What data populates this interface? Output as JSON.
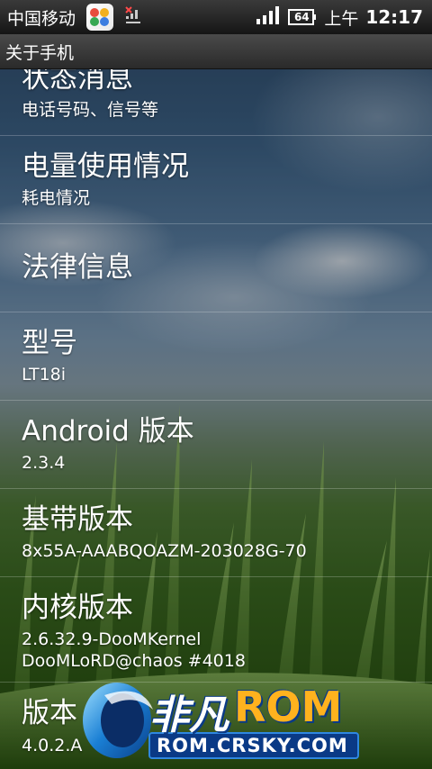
{
  "statusbar": {
    "carrier": "中国移动",
    "battery": "64",
    "ampm": "上午",
    "time": "12:17"
  },
  "titlebar": {
    "title": "关于手机"
  },
  "items": [
    {
      "title": "状态消息",
      "subtitle": "电话号码、信号等"
    },
    {
      "title": "电量使用情况",
      "subtitle": "耗电情况"
    },
    {
      "title": "法律信息",
      "subtitle": ""
    },
    {
      "title": "型号",
      "subtitle": "LT18i"
    },
    {
      "title": "Android 版本",
      "subtitle": "2.3.4"
    },
    {
      "title": "基带版本",
      "subtitle": "8x55A-AAABQOAZM-203028G-70"
    },
    {
      "title": "内核版本",
      "subtitle": "2.6.32.9-DooMKernel",
      "subtitle2": "DooMLoRD@chaos #4018"
    },
    {
      "title": "版本",
      "subtitle": "4.0.2.A"
    }
  ],
  "watermark": {
    "brand_cn": "非凡",
    "brand_en": "ROM",
    "url": "ROM.CRSKY.COM"
  }
}
